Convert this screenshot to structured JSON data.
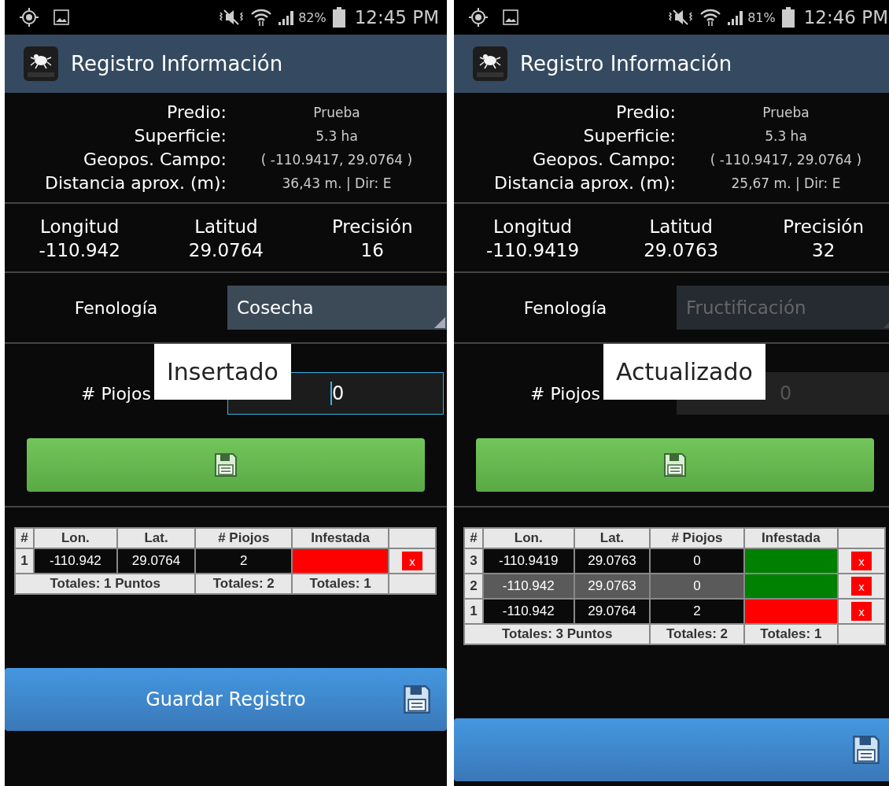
{
  "screens": [
    {
      "status": {
        "battery": "82%",
        "time": "12:45 PM"
      },
      "title": "Registro Información",
      "info": [
        {
          "label": "Predio:",
          "value": "Prueba"
        },
        {
          "label": "Superficie:",
          "value": "5.3 ha"
        },
        {
          "label": "Geopos. Campo:",
          "value": "( -110.9417, 29.0764 )"
        },
        {
          "label": "Distancia aprox. (m):",
          "value": "36,43 m. | Dir: E"
        }
      ],
      "coords": [
        {
          "label": "Longitud",
          "value": "-110.942"
        },
        {
          "label": "Latitud",
          "value": "29.0764"
        },
        {
          "label": "Precisión",
          "value": "16"
        }
      ],
      "fenologia": {
        "label": "Fenología",
        "value": "Cosecha",
        "disabled": false
      },
      "piojos": {
        "label": "# Piojos",
        "value": "0",
        "disabled": false,
        "focused": true
      },
      "toast": "Insertado",
      "table": {
        "columns": [
          "#",
          "Lon.",
          "Lat.",
          "# Piojos",
          "Infestada"
        ],
        "rows": [
          {
            "n": "1",
            "lon": "-110.942",
            "lat": "29.0764",
            "piojos": "2",
            "color": "#ff0000",
            "selected": false,
            "delete": "x"
          }
        ],
        "totals": [
          "Totales: 1 Puntos",
          "Totales: 2",
          "Totales: 1"
        ]
      },
      "guardar": {
        "label": "Guardar Registro"
      }
    },
    {
      "status": {
        "battery": "81%",
        "time": "12:46 PM"
      },
      "title": "Registro Información",
      "info": [
        {
          "label": "Predio:",
          "value": "Prueba"
        },
        {
          "label": "Superficie:",
          "value": "5.3 ha"
        },
        {
          "label": "Geopos. Campo:",
          "value": "( -110.9417, 29.0764 )"
        },
        {
          "label": "Distancia aprox. (m):",
          "value": "25,67 m. | Dir: E"
        }
      ],
      "coords": [
        {
          "label": "Longitud",
          "value": "-110.9419"
        },
        {
          "label": "Latitud",
          "value": "29.0763"
        },
        {
          "label": "Precisión",
          "value": "32"
        }
      ],
      "fenologia": {
        "label": "Fenología",
        "value": "Fructificación",
        "disabled": true
      },
      "piojos": {
        "label": "# Piojos",
        "value": "0",
        "disabled": true,
        "focused": false
      },
      "toast": "Actualizado",
      "table": {
        "columns": [
          "#",
          "Lon.",
          "Lat.",
          "# Piojos",
          "Infestada"
        ],
        "rows": [
          {
            "n": "3",
            "lon": "-110.9419",
            "lat": "29.0763",
            "piojos": "0",
            "color": "#008000",
            "selected": false,
            "delete": "x"
          },
          {
            "n": "2",
            "lon": "-110.942",
            "lat": "29.0763",
            "piojos": "0",
            "color": "#008000",
            "selected": true,
            "delete": "x"
          },
          {
            "n": "1",
            "lon": "-110.942",
            "lat": "29.0764",
            "piojos": "2",
            "color": "#ff0000",
            "selected": false,
            "delete": "x"
          }
        ],
        "totals": [
          "Totales: 3 Puntos",
          "Totales: 2",
          "Totales: 1"
        ]
      },
      "guardar_button": true
    }
  ]
}
